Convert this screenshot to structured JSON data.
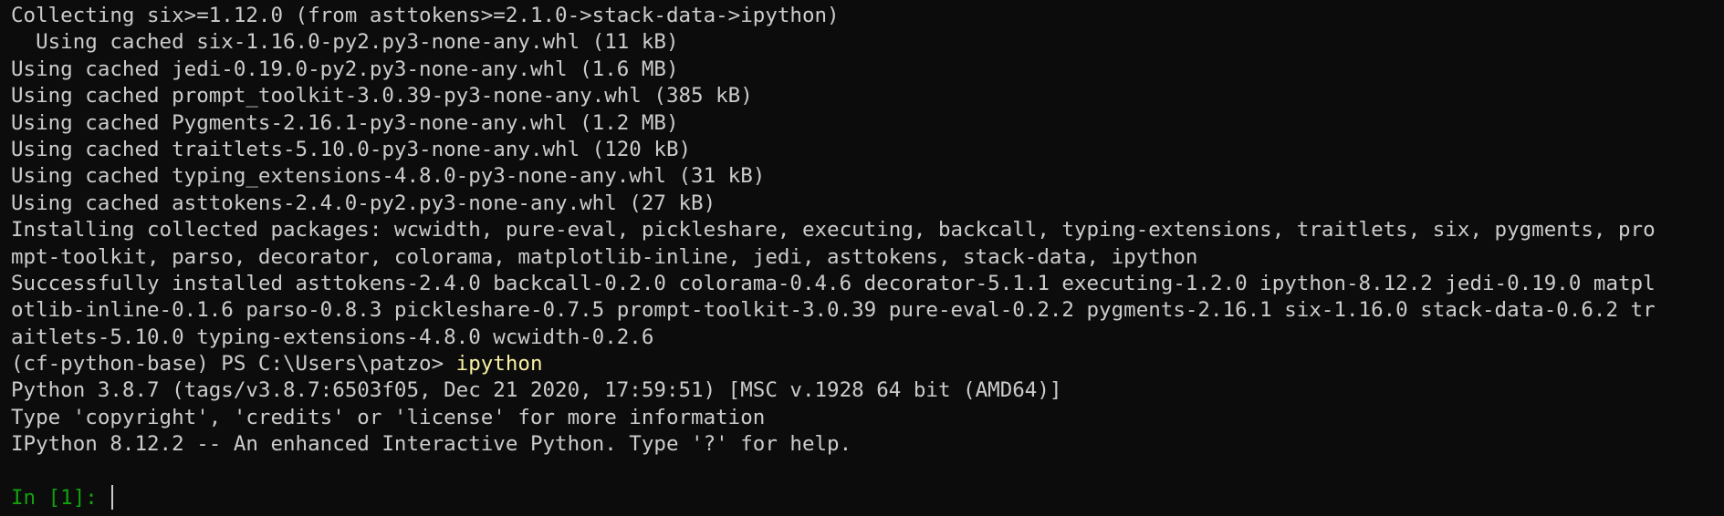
{
  "terminal": {
    "partial_top_line": "                                                                                  ",
    "lines": [
      "Collecting six>=1.12.0 (from asttokens>=2.1.0->stack-data->ipython)",
      "  Using cached six-1.16.0-py2.py3-none-any.whl (11 kB)",
      "Using cached jedi-0.19.0-py2.py3-none-any.whl (1.6 MB)",
      "Using cached prompt_toolkit-3.0.39-py3-none-any.whl (385 kB)",
      "Using cached Pygments-2.16.1-py3-none-any.whl (1.2 MB)",
      "Using cached traitlets-5.10.0-py3-none-any.whl (120 kB)",
      "Using cached typing_extensions-4.8.0-py3-none-any.whl (31 kB)",
      "Using cached asttokens-2.4.0-py2.py3-none-any.whl (27 kB)",
      "Installing collected packages: wcwidth, pure-eval, pickleshare, executing, backcall, typing-extensions, traitlets, six, pygments, pro",
      "mpt-toolkit, parso, decorator, colorama, matplotlib-inline, jedi, asttokens, stack-data, ipython",
      "Successfully installed asttokens-2.4.0 backcall-0.2.0 colorama-0.4.6 decorator-5.1.1 executing-1.2.0 ipython-8.12.2 jedi-0.19.0 matpl",
      "otlib-inline-0.1.6 parso-0.8.3 pickleshare-0.7.5 prompt-toolkit-3.0.39 pure-eval-0.2.2 pygments-2.16.1 six-1.16.0 stack-data-0.6.2 tr",
      "aitlets-5.10.0 typing-extensions-4.8.0 wcwidth-0.2.6"
    ],
    "ps_prompt": "(cf-python-base) PS C:\\Users\\patzo> ",
    "ps_command": "ipython",
    "banner": [
      "Python 3.8.7 (tags/v3.8.7:6503f05, Dec 21 2020, 17:59:51) [MSC v.1928 64 bit (AMD64)]",
      "Type 'copyright', 'credits' or 'license' for more information",
      "IPython 8.12.2 -- An enhanced Interactive Python. Type '?' for help."
    ],
    "blank_line": "",
    "ipython_prompt": "In [1]: ",
    "colors": {
      "background": "#0c0c0c",
      "foreground": "#cccccc",
      "command": "#f9f1a5",
      "ipython_prompt": "#13a10e"
    }
  }
}
